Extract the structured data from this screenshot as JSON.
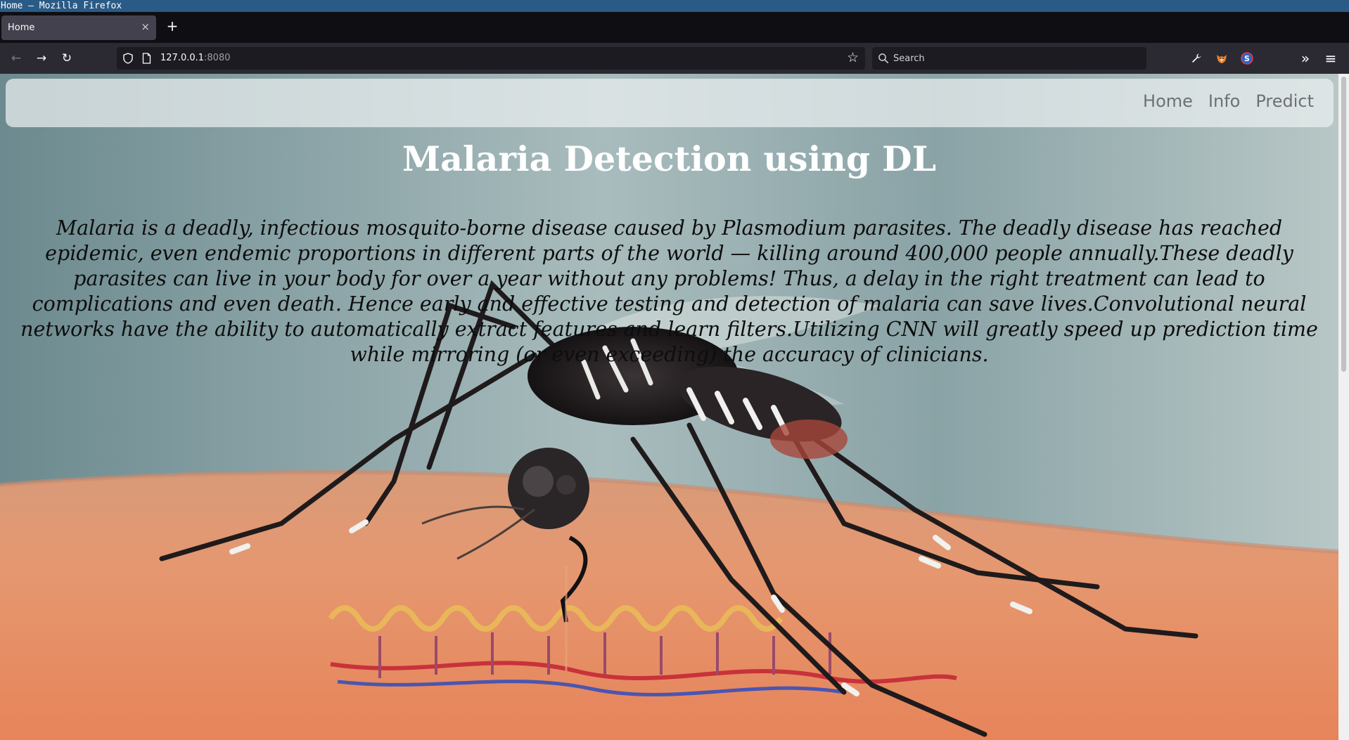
{
  "window": {
    "title": "Home — Mozilla Firefox"
  },
  "tabs": [
    {
      "label": "Home",
      "close": "×"
    }
  ],
  "tabstrip": {
    "new_tab": "+"
  },
  "toolbar": {
    "back": "←",
    "forward": "→",
    "reload": "↻",
    "url_host": "127.0.0.1",
    "url_port": ":8080",
    "bookmark": "☆",
    "search_placeholder": "Search",
    "overflow": "»",
    "menu": "≡"
  },
  "extensions": [
    {
      "name": "wrench-icon"
    },
    {
      "name": "fox-extension-icon"
    },
    {
      "name": "s-extension-icon"
    }
  ],
  "site": {
    "nav": [
      "Home",
      "Info",
      "Predict"
    ],
    "title": "Malaria Detection using DL",
    "description": "Malaria is a deadly, infectious mosquito-borne disease caused by Plasmodium parasites. The deadly disease has reached epidemic, even endemic proportions in different parts of the world — killing around 400,000 people annually.These deadly parasites can live in your body for over a year without any problems! Thus, a delay in the right treatment can lead to complications and even death. Hence early and effective testing and detection of malaria can save lives.Convolutional neural networks have the ability to automatically extract features and learn filters.Utilizing CNN will greatly speed up prediction time while mirroring (or even exceeding) the accuracy of clinicians."
  },
  "colors": {
    "title_bar": "#2a5b86",
    "tab_strip": "#0f0e13",
    "toolbar": "#2b2a33",
    "url_field": "#1c1b22",
    "site_nav": "#ebf0f1",
    "site_nav_text": "#6d7174",
    "hero_title": "#ffffff",
    "hero_text": "#0d0d0d"
  }
}
